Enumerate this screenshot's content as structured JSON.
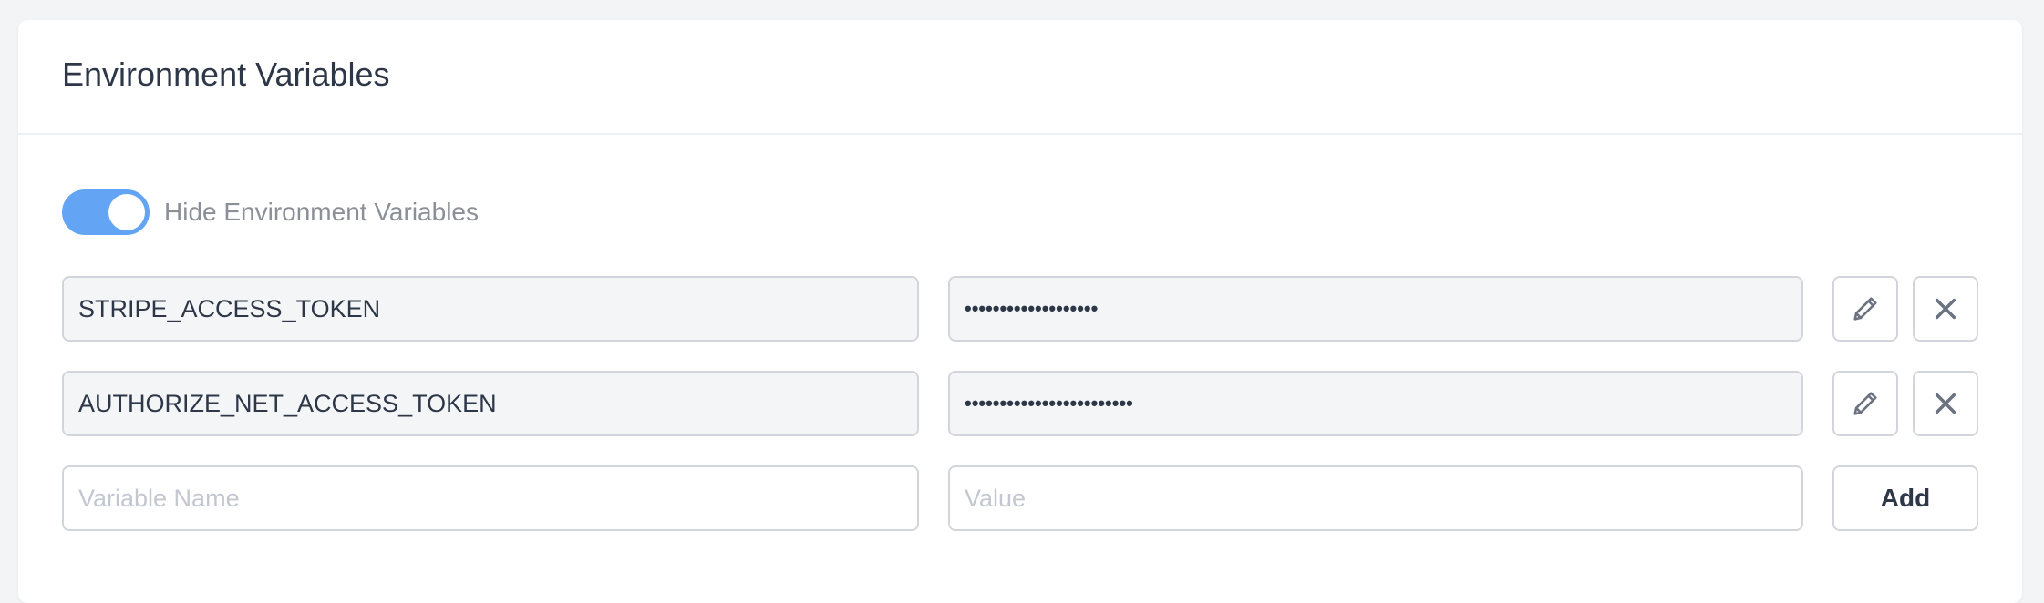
{
  "card": {
    "title": "Environment Variables"
  },
  "toggle": {
    "label": "Hide Environment Variables",
    "on": true,
    "color": "#63a4f4"
  },
  "variables": [
    {
      "name": "STRIPE_ACCESS_TOKEN",
      "value": "•••••••••••••••••••"
    },
    {
      "name": "AUTHORIZE_NET_ACCESS_TOKEN",
      "value": "••••••••••••••••••••••••"
    }
  ],
  "new_variable": {
    "name_placeholder": "Variable Name",
    "value_placeholder": "Value",
    "add_label": "Add"
  },
  "icons": {
    "edit": "pencil-icon",
    "remove": "close-icon"
  }
}
